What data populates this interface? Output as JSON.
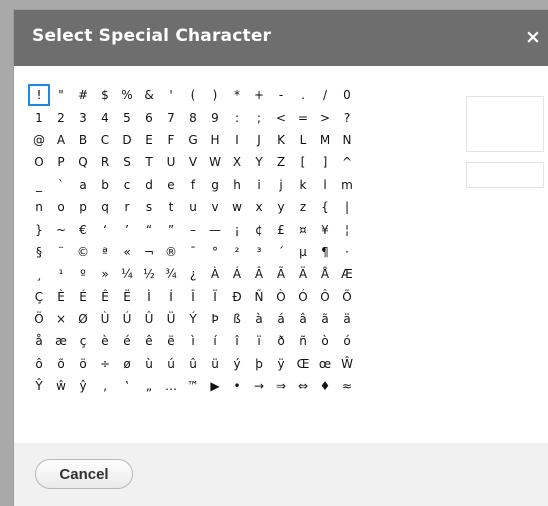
{
  "dialog": {
    "title": "Select Special Character",
    "close_symbol": "×",
    "cancel_label": "Cancel"
  },
  "characters": [
    "!",
    "\"",
    "#",
    "$",
    "%",
    "&",
    "'",
    "(",
    ")",
    "*",
    "+",
    "-",
    ".",
    "/",
    "0",
    "1",
    "2",
    "3",
    "4",
    "5",
    "6",
    "7",
    "8",
    "9",
    ":",
    ";",
    "<",
    "=",
    ">",
    "?",
    "@",
    "A",
    "B",
    "C",
    "D",
    "E",
    "F",
    "G",
    "H",
    "I",
    "J",
    "K",
    "L",
    "M",
    "N",
    "O",
    "P",
    "Q",
    "R",
    "S",
    "T",
    "U",
    "V",
    "W",
    "X",
    "Y",
    "Z",
    "[",
    "]",
    "^",
    "_",
    "`",
    "a",
    "b",
    "c",
    "d",
    "e",
    "f",
    "g",
    "h",
    "i",
    "j",
    "k",
    "l",
    "m",
    "n",
    "o",
    "p",
    "q",
    "r",
    "s",
    "t",
    "u",
    "v",
    "w",
    "x",
    "y",
    "z",
    "{",
    "|",
    "}",
    "~",
    "€",
    "‘",
    "’",
    "“",
    "”",
    "–",
    "—",
    "¡",
    "¢",
    "£",
    "¤",
    "¥",
    "¦",
    "§",
    "¨",
    "©",
    "ª",
    "«",
    "¬",
    "®",
    "¯",
    "°",
    "²",
    "³",
    "´",
    "µ",
    "¶",
    "·",
    "¸",
    "¹",
    "º",
    "»",
    "¼",
    "½",
    "¾",
    "¿",
    "À",
    "Á",
    "Â",
    "Ã",
    "Ä",
    "Å",
    "Æ",
    "Ç",
    "È",
    "É",
    "Ê",
    "Ë",
    "Ì",
    "Í",
    "Î",
    "Ï",
    "Ð",
    "Ñ",
    "Ò",
    "Ó",
    "Ô",
    "Õ",
    "Ö",
    "×",
    "Ø",
    "Ù",
    "Ú",
    "Û",
    "Ü",
    "Ý",
    "Þ",
    "ß",
    "à",
    "á",
    "â",
    "ã",
    "ä",
    "å",
    "æ",
    "ç",
    "è",
    "é",
    "ê",
    "ë",
    "ì",
    "í",
    "î",
    "ï",
    "ð",
    "ñ",
    "ò",
    "ó",
    "ô",
    "õ",
    "ö",
    "÷",
    "ø",
    "ù",
    "ú",
    "û",
    "ü",
    "ý",
    "þ",
    "ÿ",
    "Œ",
    "œ",
    "Ŵ",
    "Ŷ",
    "ŵ",
    "ŷ",
    "‚",
    "‛",
    "„",
    "…",
    "™",
    "▶",
    "•",
    "→",
    "⇒",
    "⇔",
    "♦",
    "≈"
  ],
  "colors": {
    "titlebar": "#6e6e6e",
    "selection": "#1e88e5",
    "footer": "#f1f1f1"
  }
}
